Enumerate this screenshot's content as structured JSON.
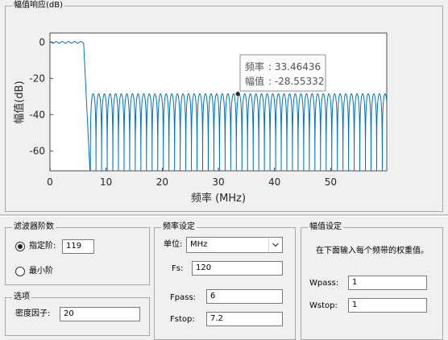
{
  "plot_panel": {
    "title": "幅值响应(dB)"
  },
  "chart_data": {
    "type": "line",
    "xlabel": "频率 (MHz)",
    "ylabel": "幅值(dB)",
    "xlim": [
      0,
      60
    ],
    "ylim": [
      -71,
      5
    ],
    "xticks": [
      0,
      10,
      20,
      30,
      40,
      50
    ],
    "yticks": [
      0,
      -20,
      -40,
      -60
    ],
    "grid": false,
    "series": [
      {
        "color": "#0072bd",
        "description_passband": {
          "x": [
            0,
            6
          ],
          "y_ripple": [
            -0.6,
            0.3
          ]
        },
        "description_transition": {
          "x": [
            6,
            7.2
          ]
        },
        "description_stopband": {
          "x": [
            7.2,
            60
          ],
          "peak_level": -28.5,
          "null_spacing": 1.0
        }
      }
    ],
    "datatip": {
      "x_label": "频率",
      "x_value": "33.46436",
      "y_label": "幅值",
      "y_value": "-28.55332",
      "x": 33.46436,
      "y": -28.55332
    }
  },
  "order_panel": {
    "title": "滤波器阶数",
    "specify_label": "指定阶:",
    "specify_value": "119",
    "specify_selected": true,
    "minimum_label": "最小阶"
  },
  "options_panel": {
    "title": "选项",
    "density_label": "密度因子:",
    "density_value": "20"
  },
  "freq_panel": {
    "title": "频率设定",
    "unit_label": "单位:",
    "unit_value": "MHz",
    "fs_label": "Fs:",
    "fs_value": "120",
    "fpass_label": "Fpass:",
    "fpass_value": "6",
    "fstop_label": "Fstop:",
    "fstop_value": "7.2"
  },
  "mag_panel": {
    "title": "幅值设定",
    "description": "在下面输入每个频带的权重值。",
    "wpass_label": "Wpass:",
    "wpass_value": "1",
    "wstop_label": "Wstop:",
    "wstop_value": "1"
  }
}
